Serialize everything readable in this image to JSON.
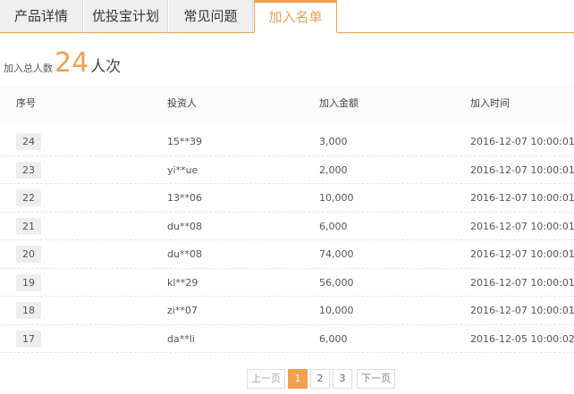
{
  "tabs": [
    {
      "label": "产品详情"
    },
    {
      "label": "优投宝计划"
    },
    {
      "label": "常见问题"
    },
    {
      "label": "加入名单"
    }
  ],
  "summary": {
    "label": "加入总人数",
    "count": "24",
    "unit": "人次"
  },
  "table": {
    "headers": [
      "序号",
      "投资人",
      "加入金额",
      "加入时间"
    ],
    "rows": [
      {
        "no": "24",
        "investor": "15**39",
        "amount": "3,000",
        "time": "2016-12-07 10:00:01"
      },
      {
        "no": "23",
        "investor": "yi**ue",
        "amount": "2,000",
        "time": "2016-12-07 10:00:01"
      },
      {
        "no": "22",
        "investor": "13**06",
        "amount": "10,000",
        "time": "2016-12-07 10:00:01"
      },
      {
        "no": "21",
        "investor": "du**08",
        "amount": "6,000",
        "time": "2016-12-07 10:00:01"
      },
      {
        "no": "20",
        "investor": "du**08",
        "amount": "74,000",
        "time": "2016-12-07 10:00:01"
      },
      {
        "no": "19",
        "investor": "kl**29",
        "amount": "56,000",
        "time": "2016-12-07 10:00:01"
      },
      {
        "no": "18",
        "investor": "zi**07",
        "amount": "10,000",
        "time": "2016-12-07 10:00:01"
      },
      {
        "no": "17",
        "investor": "da**li",
        "amount": "6,000",
        "time": "2016-12-05 10:00:02"
      }
    ]
  },
  "pager": {
    "prev": "上一页",
    "pages": [
      "1",
      "2",
      "3"
    ],
    "current": "1",
    "next": "下一页"
  },
  "colors": {
    "accent": "#f0a050",
    "tab_bg": "#efefef"
  }
}
